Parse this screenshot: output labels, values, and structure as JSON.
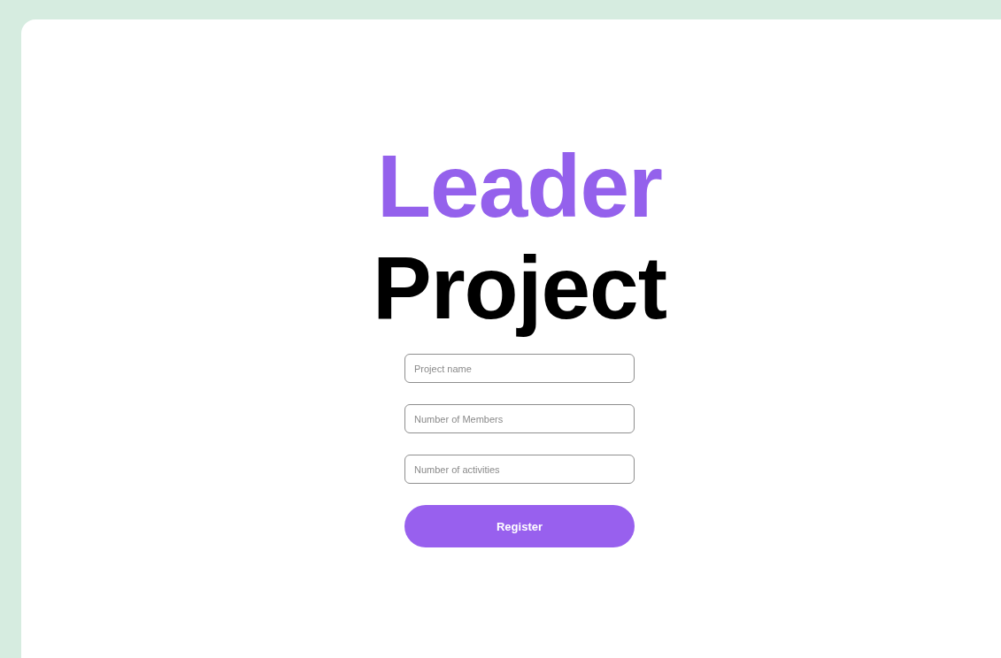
{
  "title": {
    "accent": "Leader",
    "main": "Project"
  },
  "fields": [
    {
      "placeholder": "Project name"
    },
    {
      "placeholder": "Number of Members"
    },
    {
      "placeholder": "Number of activities"
    }
  ],
  "button": "Register"
}
